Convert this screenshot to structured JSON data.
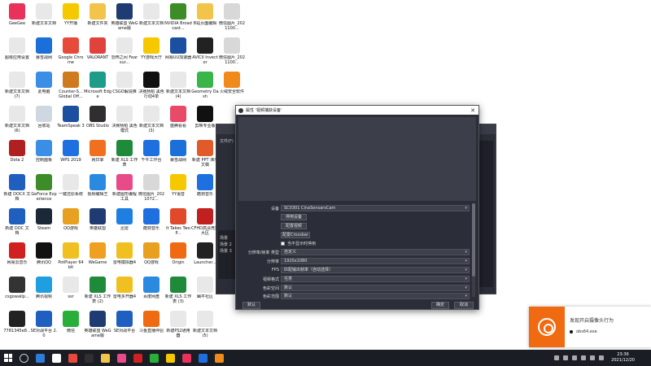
{
  "desktop_icons": [
    {
      "label": "GeeGee",
      "color": "#e8325a",
      "col": 0,
      "row": 0
    },
    {
      "label": "新建文本文档",
      "color": "#e8e8e8",
      "col": 1,
      "row": 0
    },
    {
      "label": "YY开播",
      "color": "#f5c800",
      "col": 2,
      "row": 0
    },
    {
      "label": "新建文件夹",
      "color": "#f3c44a",
      "col": 3,
      "row": 0
    },
    {
      "label": "英雄联盟 WeGame版",
      "color": "#1e3c72",
      "col": 4,
      "row": 0
    },
    {
      "label": "新建文本文档",
      "color": "#e8e8e8",
      "col": 5,
      "row": 0
    },
    {
      "label": "NVIDIA Broadcast...",
      "color": "#3c8c28",
      "col": 6,
      "row": 0
    },
    {
      "label": "B站页面编辑",
      "color": "#f3c44a",
      "col": 7,
      "row": 0
    },
    {
      "label": "微信图片_2021100...",
      "color": "#d8d8d8",
      "col": 8,
      "row": 0
    },
    {
      "label": "超级应用设置",
      "color": "#e8e8e8",
      "col": 0,
      "row": 1
    },
    {
      "label": "暴雪战网",
      "color": "#1b6fd8",
      "col": 1,
      "row": 1
    },
    {
      "label": "Google Chrome",
      "color": "#e64a3a",
      "col": 2,
      "row": 1
    },
    {
      "label": "VALORANT",
      "color": "#e0433d",
      "col": 3,
      "row": 1
    },
    {
      "label": "恐怖之间 Fear sur...",
      "color": "#e8e8e8",
      "col": 4,
      "row": 1
    },
    {
      "label": "YY游戏大厅",
      "color": "#f5c800",
      "col": 5,
      "row": 1
    },
    {
      "label": "网易UU加速器",
      "color": "#1c4fa0",
      "col": 6,
      "row": 1
    },
    {
      "label": "AVICII Invector",
      "color": "#222222",
      "col": 7,
      "row": 1
    },
    {
      "label": "微信图片_2021100...",
      "color": "#d8d8d8",
      "col": 8,
      "row": 1
    },
    {
      "label": "新建文本文档 (7)",
      "color": "#e8e8e8",
      "col": 0,
      "row": 2
    },
    {
      "label": "此电脑",
      "color": "#3a8ee6",
      "col": 1,
      "row": 2
    },
    {
      "label": "Counter-S... Global Off...",
      "color": "#d07a20",
      "col": 2,
      "row": 2
    },
    {
      "label": "Microsoft Edge",
      "color": "#1e9c8a",
      "col": 3,
      "row": 2
    },
    {
      "label": "CSGO解说推",
      "color": "#e8e8e8",
      "col": 4,
      "row": 2
    },
    {
      "label": "决赛杨柏 黑色行动4单",
      "color": "#111111",
      "col": 5,
      "row": 2
    },
    {
      "label": "新建文本文档 (4)",
      "color": "#e8e8e8",
      "col": 6,
      "row": 2
    },
    {
      "label": "Geometry Dash",
      "color": "#3ab54a",
      "col": 7,
      "row": 2
    },
    {
      "label": "火绒安全软件",
      "color": "#f08a1a",
      "col": 8,
      "row": 2
    },
    {
      "label": "新建文本文档 (6)",
      "color": "#e8e8e8",
      "col": 0,
      "row": 3
    },
    {
      "label": "回收站",
      "color": "#cfd8e0",
      "col": 1,
      "row": 3
    },
    {
      "label": "TeamSpeak 3",
      "color": "#1c4fa0",
      "col": 2,
      "row": 3
    },
    {
      "label": "OBS Studio",
      "color": "#302e31",
      "col": 3,
      "row": 3
    },
    {
      "label": "决赛杨柏 黑色模式",
      "color": "#e8e8e8",
      "col": 4,
      "row": 3
    },
    {
      "label": "新建文本文档 (3)",
      "color": "#e8e8e8",
      "col": 5,
      "row": 3
    },
    {
      "label": "盛腾看看",
      "color": "#e84a6a",
      "col": 6,
      "row": 3
    },
    {
      "label": "剪映专业版",
      "color": "#111111",
      "col": 7,
      "row": 3
    },
    {
      "label": "Dota 2",
      "color": "#b02020",
      "col": 0,
      "row": 4
    },
    {
      "label": "控制面板",
      "color": "#3a8ee6",
      "col": 1,
      "row": 4
    },
    {
      "label": "WPS 2019",
      "color": "#1e6fe0",
      "col": 2,
      "row": 4
    },
    {
      "label": "网日掌",
      "color": "#f07020",
      "col": 3,
      "row": 4
    },
    {
      "label": "新建 XLS 工作表",
      "color": "#1e8a3a",
      "col": 4,
      "row": 4
    },
    {
      "label": "千牛工作台",
      "color": "#1e6fe0",
      "col": 5,
      "row": 4
    },
    {
      "label": "暴雪战网",
      "color": "#1b6fd8",
      "col": 6,
      "row": 4
    },
    {
      "label": "新建 PPT 演示文稿",
      "color": "#e05a2a",
      "col": 7,
      "row": 4
    },
    {
      "label": "新建 DOCX 文档",
      "color": "#1e5fc0",
      "col": 0,
      "row": 5
    },
    {
      "label": "GeForce Experience",
      "color": "#3c8c28",
      "col": 1,
      "row": 5
    },
    {
      "label": "一键还原系统",
      "color": "#e8e8e8",
      "col": 2,
      "row": 5
    },
    {
      "label": "视频编辑王",
      "color": "#2a8ae0",
      "col": 3,
      "row": 5
    },
    {
      "label": "新建图形编程工具",
      "color": "#e84a8a",
      "col": 4,
      "row": 5
    },
    {
      "label": "微信图片_2021072...",
      "color": "#d8d8d8",
      "col": 5,
      "row": 5
    },
    {
      "label": "YY语音",
      "color": "#f5c800",
      "col": 6,
      "row": 5
    },
    {
      "label": "酷狗音乐",
      "color": "#1e6fe0",
      "col": 7,
      "row": 5
    },
    {
      "label": "新建 DOC 文档",
      "color": "#1e5fc0",
      "col": 0,
      "row": 6
    },
    {
      "label": "Steam",
      "color": "#1b2838",
      "col": 1,
      "row": 6
    },
    {
      "label": "QQ游戏",
      "color": "#e8a020",
      "col": 2,
      "row": 6
    },
    {
      "label": "英雄联盟",
      "color": "#1e3c72",
      "col": 3,
      "row": 6
    },
    {
      "label": "迅雷",
      "color": "#1e7fe0",
      "col": 4,
      "row": 6
    },
    {
      "label": "酷狗音乐",
      "color": "#1e6fe0",
      "col": 5,
      "row": 6
    },
    {
      "label": "It Takes Two P...",
      "color": "#e04a2a",
      "col": 6,
      "row": 6
    },
    {
      "label": "CFHD高清竞技大区",
      "color": "#c02020",
      "col": 7,
      "row": 6
    },
    {
      "label": "网易云音乐",
      "color": "#d02020",
      "col": 0,
      "row": 7
    },
    {
      "label": "腾讯QQ",
      "color": "#111111",
      "col": 1,
      "row": 7
    },
    {
      "label": "PotPlayer 64 bit",
      "color": "#f0c020",
      "col": 2,
      "row": 7
    },
    {
      "label": "WeGame",
      "color": "#f0a020",
      "col": 3,
      "row": 7
    },
    {
      "label": "雷电模拟器4",
      "color": "#f0c020",
      "col": 4,
      "row": 7
    },
    {
      "label": "QQ游戏",
      "color": "#e8a020",
      "col": 5,
      "row": 7
    },
    {
      "label": "Origin",
      "color": "#f06a12",
      "col": 6,
      "row": 7
    },
    {
      "label": "Launcher...",
      "color": "#222222",
      "col": 7,
      "row": 7
    },
    {
      "label": "csgowallp...",
      "color": "#333333",
      "col": 0,
      "row": 8
    },
    {
      "label": "腾讯视频",
      "color": "#1ea0e0",
      "col": 1,
      "row": 8
    },
    {
      "label": "ssr",
      "color": "#e8e8e8",
      "col": 2,
      "row": 8
    },
    {
      "label": "新建 XLS 工作表 (2)",
      "color": "#1e8a3a",
      "col": 3,
      "row": 8
    },
    {
      "label": "雷电多开器4",
      "color": "#f0c020",
      "col": 4,
      "row": 8
    },
    {
      "label": "百度网盘",
      "color": "#2a8ae0",
      "col": 5,
      "row": 8
    },
    {
      "label": "新建 XLS 工作表 (3)",
      "color": "#1e8a3a",
      "col": 6,
      "row": 8
    },
    {
      "label": "幽平社区",
      "color": "#e8e8e8",
      "col": 7,
      "row": 8
    },
    {
      "label": "7781345e8...",
      "color": "#222222",
      "col": 0,
      "row": 9
    },
    {
      "label": "SE对战平台 2.0",
      "color": "#1e5fc0",
      "col": 1,
      "row": 9
    },
    {
      "label": "微信",
      "color": "#2aae3a",
      "col": 2,
      "row": 9
    },
    {
      "label": "英雄联盟 WeGame版",
      "color": "#1e3c72",
      "col": 3,
      "row": 9
    },
    {
      "label": "SE对战平台",
      "color": "#1e5fc0",
      "col": 4,
      "row": 9
    },
    {
      "label": "斗鱼直播伴侣",
      "color": "#f06a12",
      "col": 5,
      "row": 9
    },
    {
      "label": "新建PS2通用器",
      "color": "#e8e8e8",
      "col": 6,
      "row": 9
    },
    {
      "label": "新建文本文档 (5)",
      "color": "#e8e8e8",
      "col": 7,
      "row": 9
    }
  ],
  "obs_bg": {
    "scenes_label": "场景",
    "scene_items": [
      "场景 2",
      "场景 3"
    ],
    "file_label": "文件(F)"
  },
  "dialog": {
    "title": "属性 '视频捕获设备'",
    "close": "✕",
    "device_label": "设备",
    "device_value": "SC0301 CinaSensarsCam",
    "btn_deactivate": "停用设备",
    "btn_configure_video": "配置视频",
    "btn_configure_crossbar": "配置Crossbar",
    "checkbox_label": "当不显示时停用",
    "res_type_label": "分辨率/帧率 类型",
    "res_type_value": "自定义",
    "resolution_label": "分辨率",
    "resolution_value": "1920x1080",
    "fps_label": "FPS",
    "fps_value": "匹配输出帧率（自动选择）",
    "video_format_label": "视频格式",
    "video_format_value": "任意",
    "color_space_label": "色彩空间",
    "color_space_value": "默认",
    "color_range_label": "色彩范围",
    "color_range_value": "默认",
    "defaults_button": "默认",
    "ok_button": "确定",
    "cancel_button": "取消"
  },
  "notification": {
    "title": "发现开启摄像头行为",
    "process": "obs64.exe"
  },
  "taskbar": {
    "apps": [
      "#2e7bd8",
      "#ffffff",
      "#e64a3a",
      "#302e31",
      "#f3c44a",
      "#e84a8a",
      "#d02020",
      "#2aae3a",
      "#f5c800",
      "#e8325a",
      "#1e6fe0",
      "#f08a1a"
    ],
    "time": "23:36",
    "date": "2021/12/20"
  }
}
